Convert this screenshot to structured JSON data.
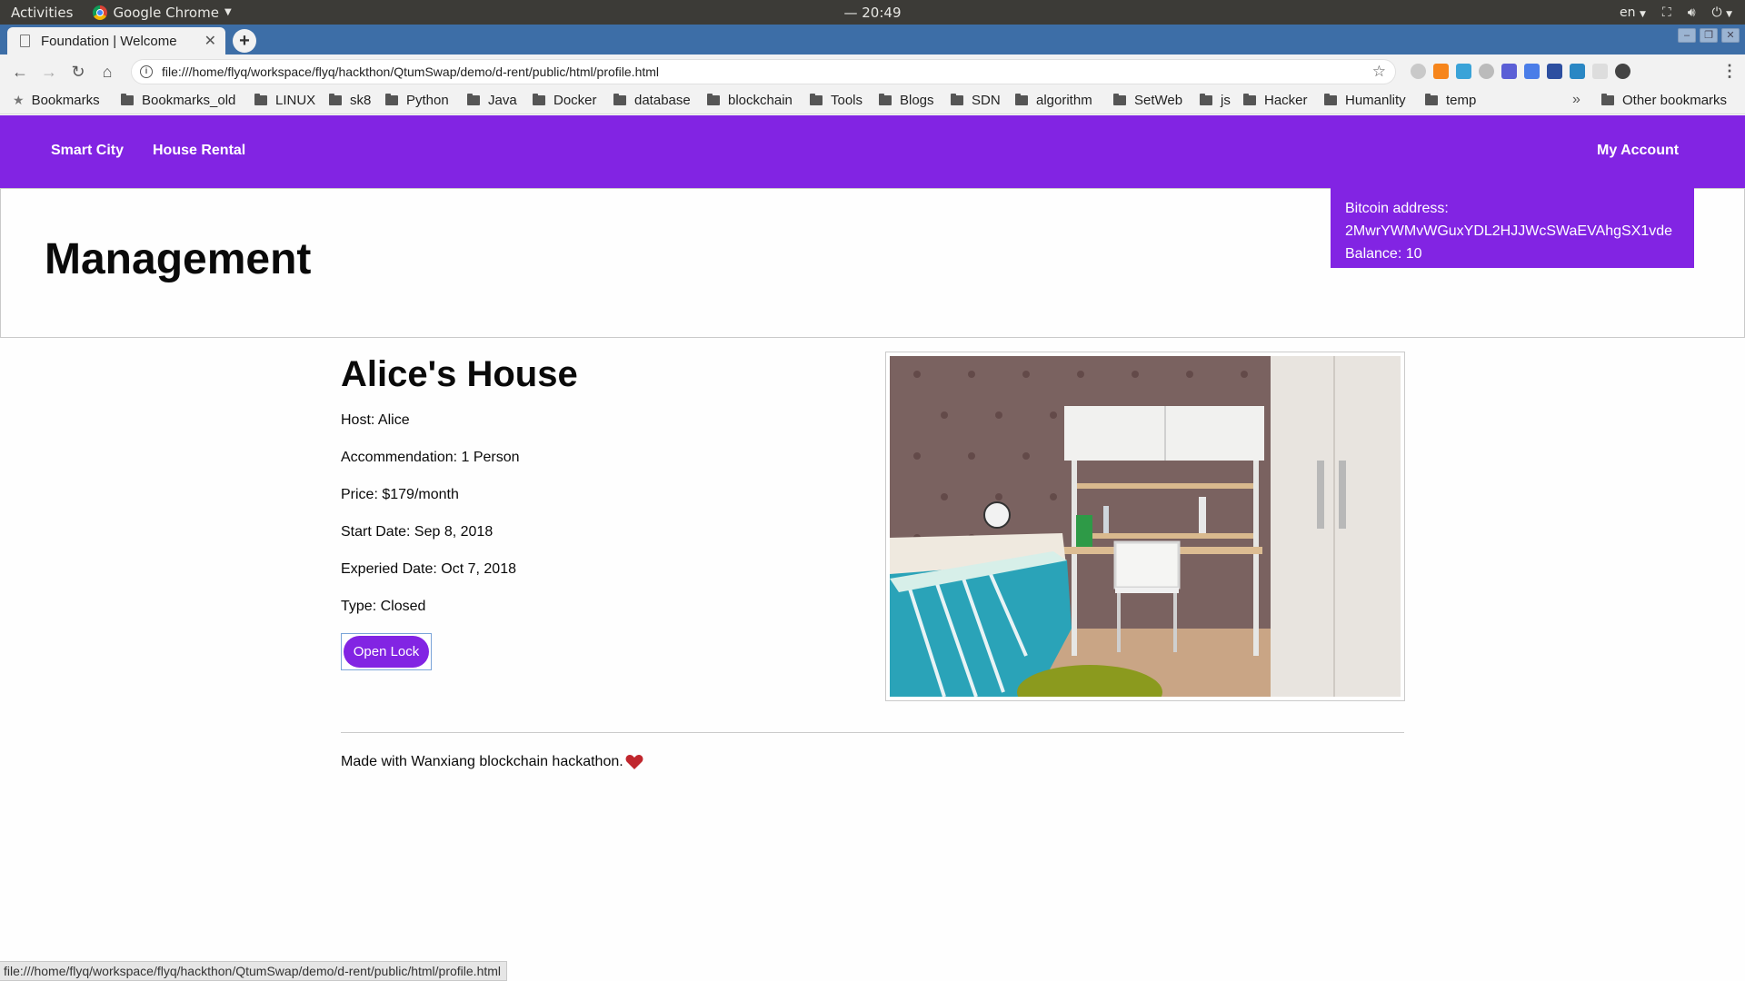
{
  "os": {
    "activities": "Activities",
    "app_name": "Google Chrome",
    "clock": "— 20:49",
    "lang": "en"
  },
  "browser": {
    "tab_title": "Foundation | Welcome",
    "url": "file:///home/flyq/workspace/flyq/hackthon/QtumSwap/demo/d-rent/public/html/profile.html",
    "bookmarks": [
      "Bookmarks",
      "Bookmarks_old",
      "LINUX",
      "sk8",
      "Python",
      "Java",
      "Docker",
      "database",
      "blockchain",
      "Tools",
      "Blogs",
      "SDN",
      "algorithm",
      "SetWeb",
      "js",
      "Hacker",
      "Humanlity",
      "temp"
    ],
    "other_bookmarks": "Other bookmarks",
    "status_url": "file:///home/flyq/workspace/flyq/hackthon/QtumSwap/demo/d-rent/public/html/profile.html"
  },
  "nav": {
    "smart_city": "Smart City",
    "house_rental": "House Rental",
    "my_account": "My Account"
  },
  "account": {
    "address_label": "Bitcoin address:",
    "address": "2MwrYWMvWGuxYDL2HJJWcSWaEVAhgSX1vde",
    "balance": "Balance: 10"
  },
  "page": {
    "title": "Management"
  },
  "house": {
    "name": "Alice's House",
    "host": "Host: Alice",
    "accommodation": "Accommendation: 1 Person",
    "price": "Price: $179/month",
    "start_date": "Start Date: Sep 8, 2018",
    "expired_date": "Experied Date: Oct 7, 2018",
    "type": "Type: Closed",
    "open_lock_label": "Open Lock"
  },
  "footer": {
    "text": "Made with Wanxiang blockchain hackathon."
  },
  "colors": {
    "brand": "#8224e3",
    "heart": "#c0262d"
  }
}
